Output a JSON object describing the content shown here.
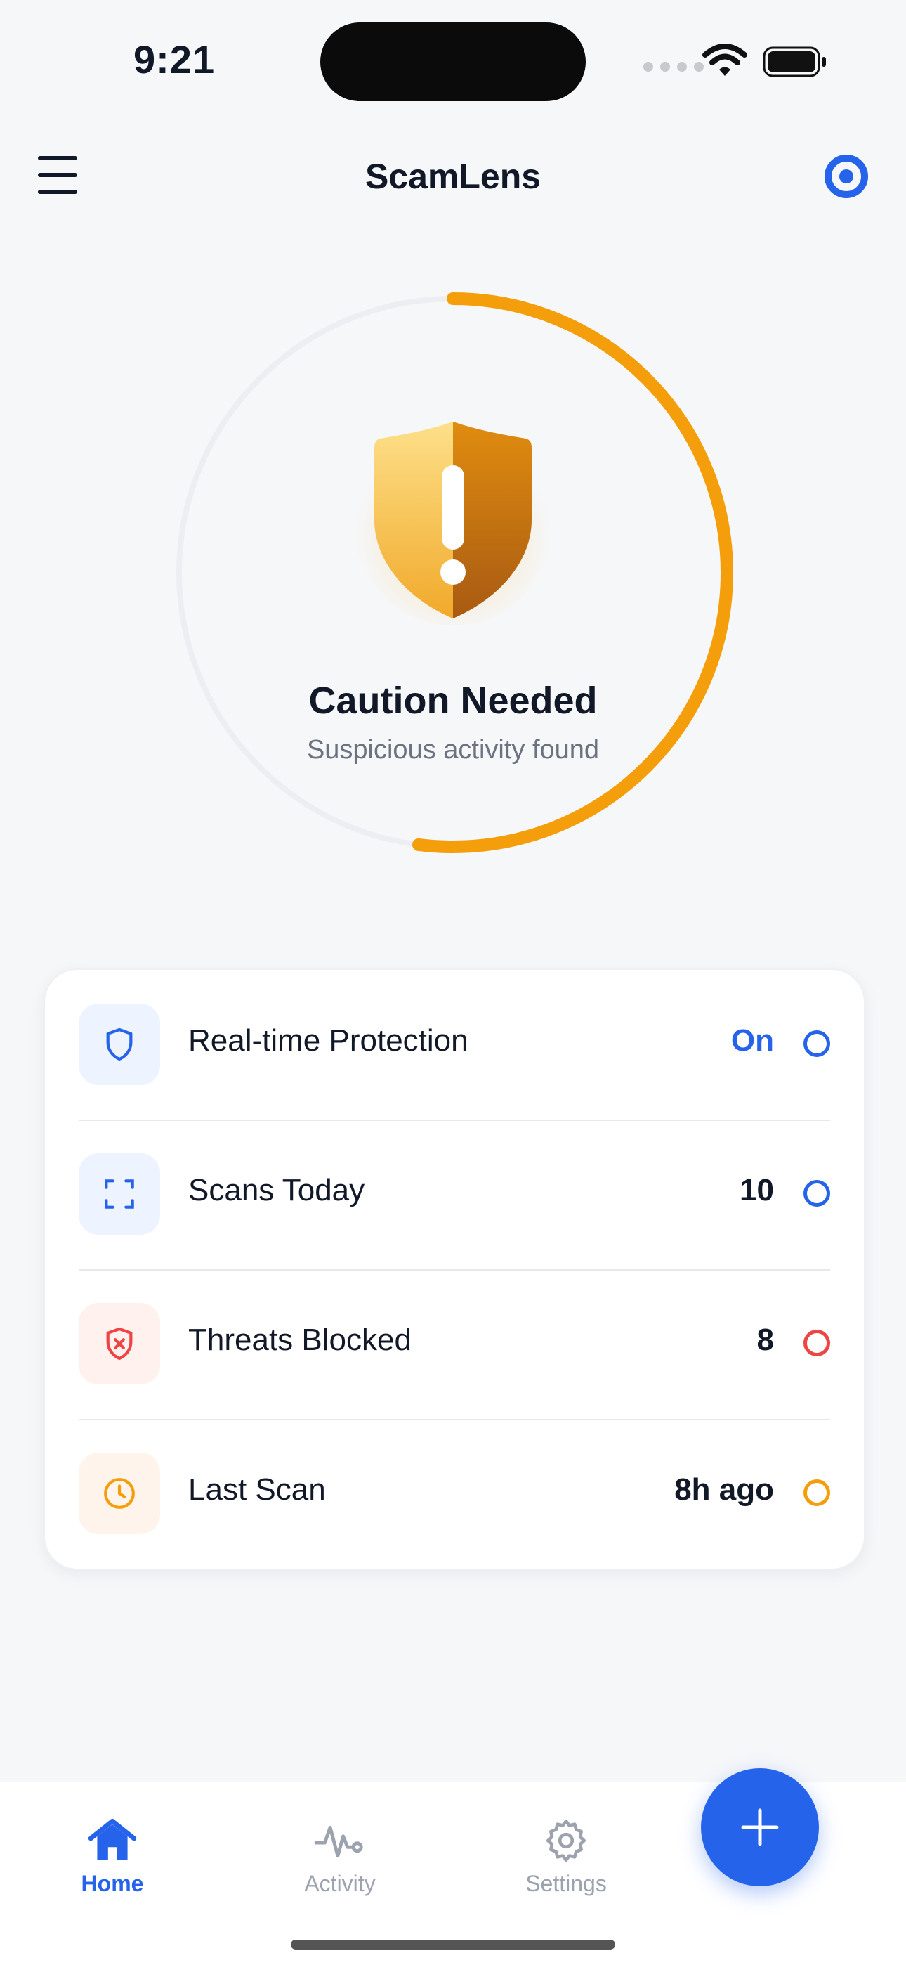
{
  "status_bar": {
    "time": "9:21"
  },
  "header": {
    "title": "ScamLens"
  },
  "status": {
    "title": "Caution Needed",
    "subtitle": "Suspicious activity found",
    "level": 0.52,
    "color": "#f59e0b"
  },
  "stats": [
    {
      "label": "Real-time Protection",
      "value": "On",
      "value_color": "#2563eb",
      "dot_color": "#2563eb",
      "icon": "shield-icon",
      "icon_bg": "#eef4ff"
    },
    {
      "label": "Scans Today",
      "value": "10",
      "value_color": "#111827",
      "dot_color": "#2563eb",
      "icon": "scan-frame-icon",
      "icon_bg": "#eef4ff"
    },
    {
      "label": "Threats Blocked",
      "value": "8",
      "value_color": "#111827",
      "dot_color": "#ef4444",
      "icon": "shield-x-icon",
      "icon_bg": "#fff1ee"
    },
    {
      "label": "Last Scan",
      "value": "8h ago",
      "value_color": "#111827",
      "dot_color": "#f59e0b",
      "icon": "clock-icon",
      "icon_bg": "#fff4ec"
    }
  ],
  "nav": {
    "items": [
      {
        "label": "Home",
        "active": true
      },
      {
        "label": "Activity",
        "active": false
      },
      {
        "label": "Settings",
        "active": false
      }
    ],
    "active_color": "#2563eb",
    "inactive_color": "#9ca3af"
  },
  "colors": {
    "accent": "#2563eb",
    "warning": "#f59e0b",
    "danger": "#ef4444"
  }
}
